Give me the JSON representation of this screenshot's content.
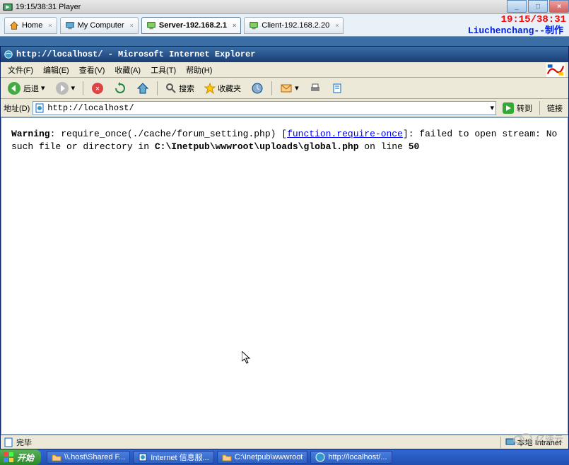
{
  "player": {
    "title": "19:15/38:31 Player",
    "win_min": "_",
    "win_max": "□",
    "win_close": "×"
  },
  "overlay_timestamp": "19:15/38:31",
  "tabs": {
    "items": [
      {
        "label": "Home"
      },
      {
        "label": "My Computer"
      },
      {
        "label": "Server-192.168.2.1"
      },
      {
        "label": "Client-192.168.2.20"
      }
    ]
  },
  "watermark_author": "Liuchenchang--制作",
  "ie": {
    "title": "http://localhost/ - Microsoft Internet Explorer",
    "menu": {
      "file": "文件(F)",
      "edit": "编辑(E)",
      "view": "查看(V)",
      "favorites": "收藏(A)",
      "tools": "工具(T)",
      "help": "帮助(H)"
    },
    "toolbar": {
      "back": "后退",
      "search": "搜索",
      "favorites": "收藏夹"
    },
    "addressbar": {
      "label": "地址(D)",
      "url": "http://localhost/",
      "go": "转到",
      "links": "链接"
    },
    "content": {
      "warning_label": "Warning",
      "msg_part1": ": require_once(./cache/forum_setting.php) [",
      "link_text": "function.require-once",
      "msg_part2": "]: failed to open stream: No such file or directory in ",
      "file_path": "C:\\Inetpub\\wwwroot\\uploads\\global.php",
      "msg_part3": " on line ",
      "line_no": "50"
    },
    "status": {
      "done": "完毕",
      "zone": "本地 Intranet"
    }
  },
  "taskbar": {
    "start": "开始",
    "items": [
      {
        "label": "\\\\.host\\Shared F..."
      },
      {
        "label": "Internet 信息服..."
      },
      {
        "label": "C:\\Inetpub\\wwwroot"
      },
      {
        "label": "http://localhost/..."
      }
    ]
  },
  "cloud_watermark": "亿速云"
}
